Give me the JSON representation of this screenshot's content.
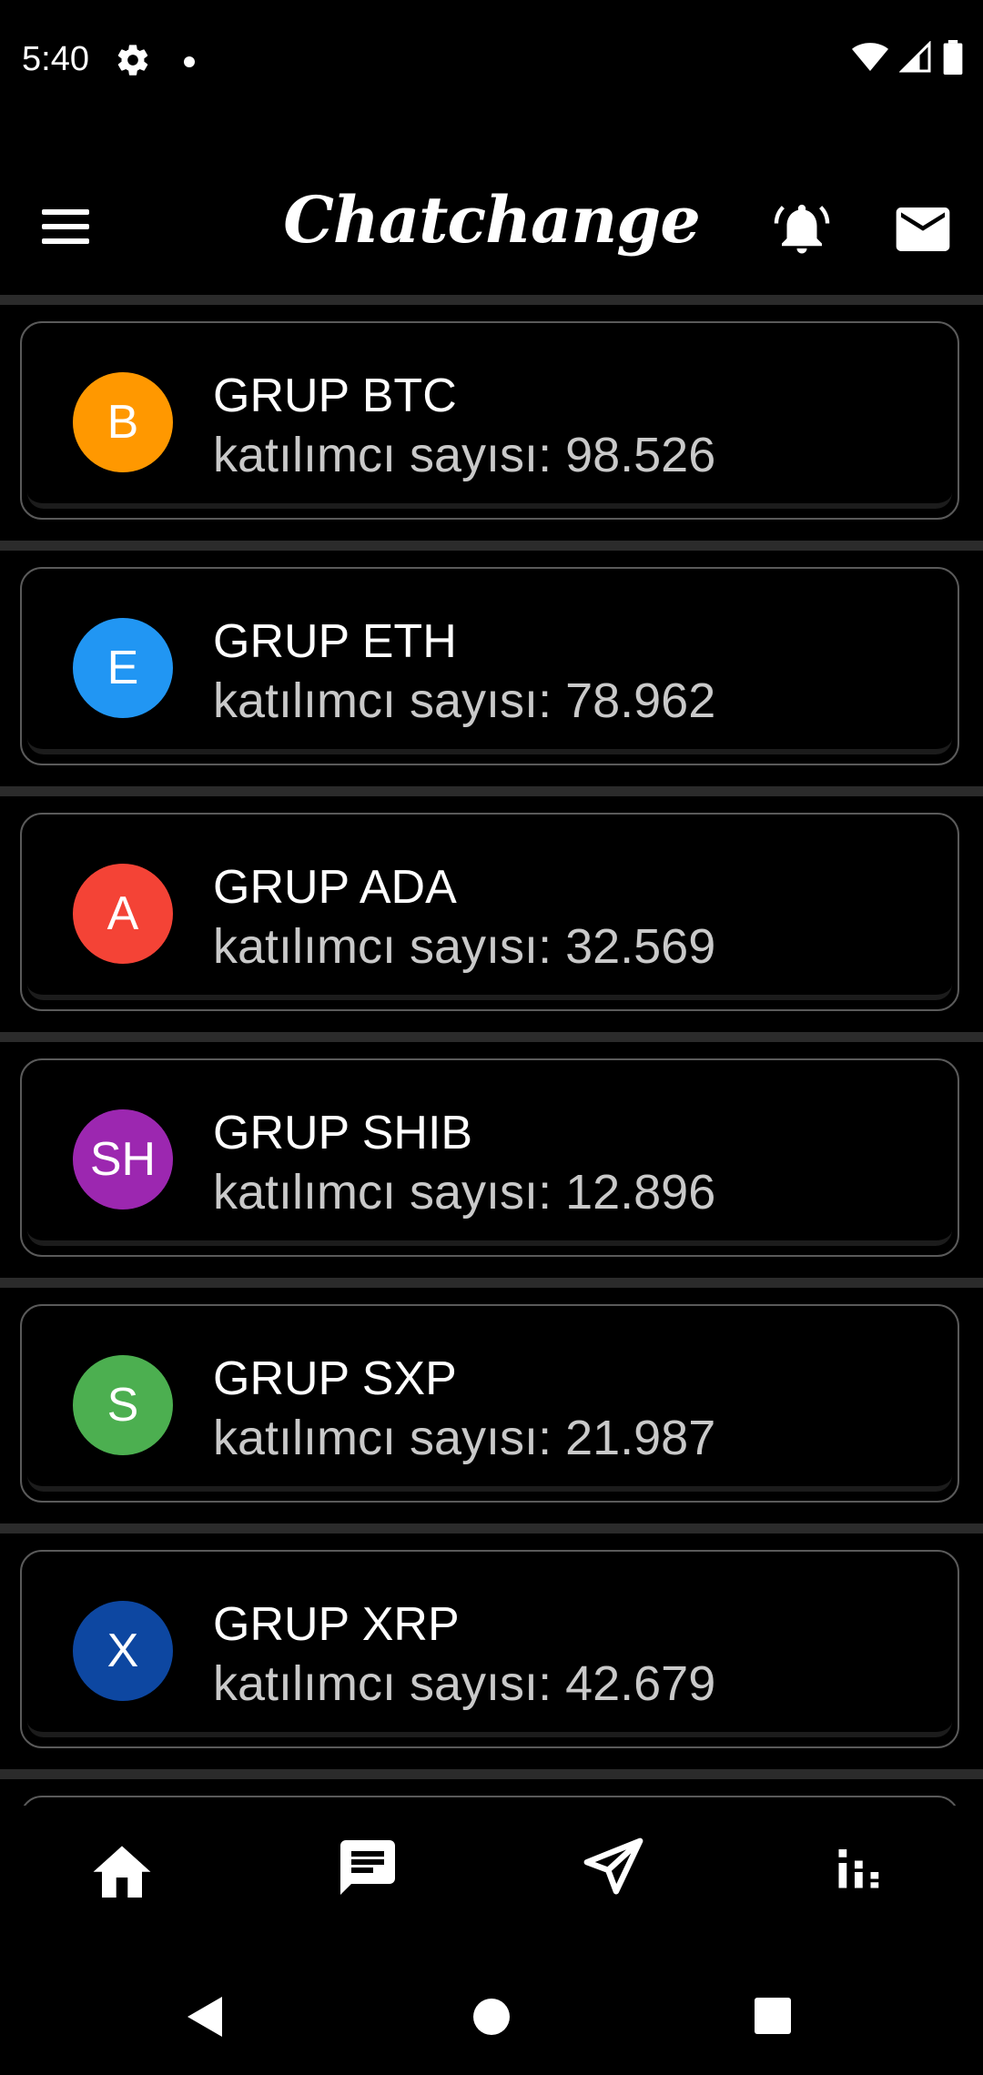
{
  "status_bar": {
    "time": "5:40"
  },
  "app_bar": {
    "title": "Chatchange"
  },
  "groups": [
    {
      "letter": "B",
      "name": "GRUP BTC",
      "count": "katılımcı sayısı: 98.526",
      "color": "#FF9800"
    },
    {
      "letter": "E",
      "name": "GRUP ETH",
      "count": "katılımcı sayısı: 78.962",
      "color": "#2196F3"
    },
    {
      "letter": "A",
      "name": "GRUP ADA",
      "count": "katılımcı sayısı: 32.569",
      "color": "#F44336"
    },
    {
      "letter": "SH",
      "name": "GRUP SHIB",
      "count": "katılımcı sayısı: 12.896",
      "color": "#9C27B0"
    },
    {
      "letter": "S",
      "name": "GRUP SXP",
      "count": "katılımcı sayısı: 21.987",
      "color": "#4CAF50"
    },
    {
      "letter": "X",
      "name": "GRUP XRP",
      "count": "katılımcı sayısı: 42.679",
      "color": "#0D47A1"
    }
  ],
  "bottom_nav": {
    "items": [
      "home-icon",
      "chat-icon",
      "send-icon",
      "stats-icon"
    ]
  },
  "system_nav": {
    "items": [
      "back-icon",
      "home-circle-icon",
      "recents-icon"
    ]
  }
}
